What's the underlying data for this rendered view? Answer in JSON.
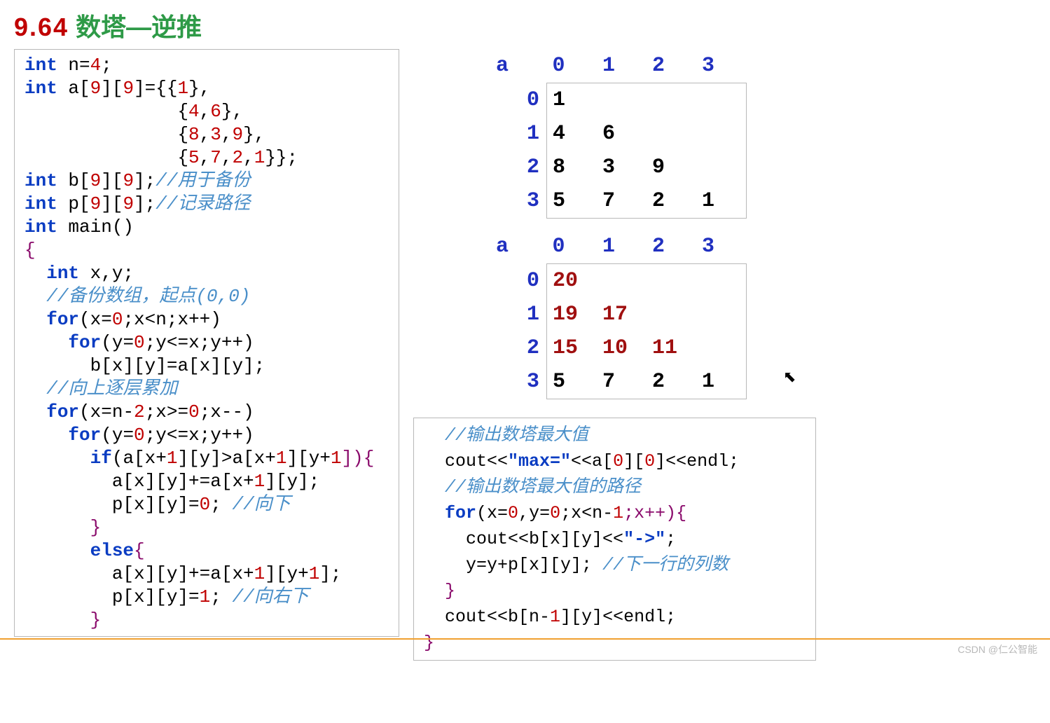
{
  "title_num": "9.64",
  "title_text": "数塔—逆推",
  "code_left": {
    "l1a": "int",
    "l1b": " n=",
    "l1c": "4",
    "l1d": ";",
    "l2a": "int",
    "l2b": " a[",
    "l2c": "9",
    "l2d": "][",
    "l2e": "9",
    "l2f": "]={{",
    "l2g": "1",
    "l2h": "},",
    "l3a": "{",
    "l3b": "4",
    "l3c": ",",
    "l3d": "6",
    "l3e": "},",
    "l4a": "{",
    "l4b": "8",
    "l4c": ",",
    "l4d": "3",
    "l4e": ",",
    "l4f": "9",
    "l4g": "},",
    "l5a": "{",
    "l5b": "5",
    "l5c": ",",
    "l5d": "7",
    "l5e": ",",
    "l5f": "2",
    "l5g": ",",
    "l5h": "1",
    "l5i": "}};",
    "l6a": "int",
    "l6b": " b[",
    "l6c": "9",
    "l6d": "][",
    "l6e": "9",
    "l6f": "];",
    "l6g": "//用于备份",
    "l7a": "int",
    "l7b": " p[",
    "l7c": "9",
    "l7d": "][",
    "l7e": "9",
    "l7f": "];",
    "l7g": "//记录路径",
    "l8a": "int",
    "l8b": " main()",
    "l9": "{",
    "l10a": "int",
    "l10b": " x,y;",
    "l11": "//备份数组，起点(0,0)",
    "l12a": "for",
    "l12b": "(x=",
    "l12c": "0",
    "l12d": ";x<n;x++)",
    "l13a": "for",
    "l13b": "(y=",
    "l13c": "0",
    "l13d": ";y<=x;y++)",
    "l14": "b[x][y]=a[x][y];",
    "l15": "//向上逐层累加",
    "l16a": "for",
    "l16b": "(x=n-",
    "l16c": "2",
    "l16d": ";x>=",
    "l16e": "0",
    "l16f": ";x--)",
    "l17a": "for",
    "l17b": "(y=",
    "l17c": "0",
    "l17d": ";y<=x;y++)",
    "l18a": "if",
    "l18b": "(a[x+",
    "l18c": "1",
    "l18d": "][y]>a[x+",
    "l18e": "1",
    "l18f": "][y+",
    "l18g": "1",
    "l18h": "]){",
    "l19a": "a[x][y]+=a[x+",
    "l19b": "1",
    "l19c": "][y];",
    "l20a": "p[x][y]=",
    "l20b": "0",
    "l20c": "; ",
    "l20d": "//向下",
    "l21": "}",
    "l22a": "else",
    "l22b": "{",
    "l23a": "a[x][y]+=a[x+",
    "l23b": "1",
    "l23c": "][y+",
    "l23d": "1",
    "l23e": "];",
    "l24a": "p[x][y]=",
    "l24b": "1",
    "l24c": "; ",
    "l24d": "//向右下",
    "l25": "}"
  },
  "code_right": {
    "r1": "//输出数塔最大值",
    "r2a": "cout<<",
    "r2b": "\"max=\"",
    "r2c": "<<a[",
    "r2d": "0",
    "r2e": "][",
    "r2f": "0",
    "r2g": "]<<endl;",
    "r3": "//输出数塔最大值的路径",
    "r4a": "for",
    "r4b": "(x=",
    "r4c": "0",
    "r4d": ",y=",
    "r4e": "0",
    "r4f": ";x<n-",
    "r4g": "1",
    "r4h": ";x++){",
    "r5a": "cout<<b[x][y]<<",
    "r5b": "\"->\"",
    "r5c": ";",
    "r6a": "y=y+p[x][y]; ",
    "r6b": "//下一行的列数",
    "r7": "}",
    "r8a": "cout<<b[n-",
    "r8b": "1",
    "r8c": "][y]<<endl;",
    "r9": "}"
  },
  "table1": {
    "label": "a",
    "cols": [
      "0",
      "1",
      "2",
      "3"
    ],
    "rows": [
      "0",
      "1",
      "2",
      "3"
    ],
    "data": [
      [
        "1",
        "",
        "",
        ""
      ],
      [
        "4",
        "6",
        "",
        ""
      ],
      [
        "8",
        "3",
        "9",
        ""
      ],
      [
        "5",
        "7",
        "2",
        "1"
      ]
    ]
  },
  "table2": {
    "label": "a",
    "cols": [
      "0",
      "1",
      "2",
      "3"
    ],
    "rows": [
      "0",
      "1",
      "2",
      "3"
    ],
    "data": [
      [
        "20",
        "",
        "",
        ""
      ],
      [
        "19",
        "17",
        "",
        ""
      ],
      [
        "15",
        "10",
        "11",
        ""
      ],
      [
        "5",
        "7",
        "2",
        "1"
      ]
    ],
    "red_rows": [
      0,
      1,
      2
    ]
  },
  "watermark": "CSDN @仁公智能"
}
